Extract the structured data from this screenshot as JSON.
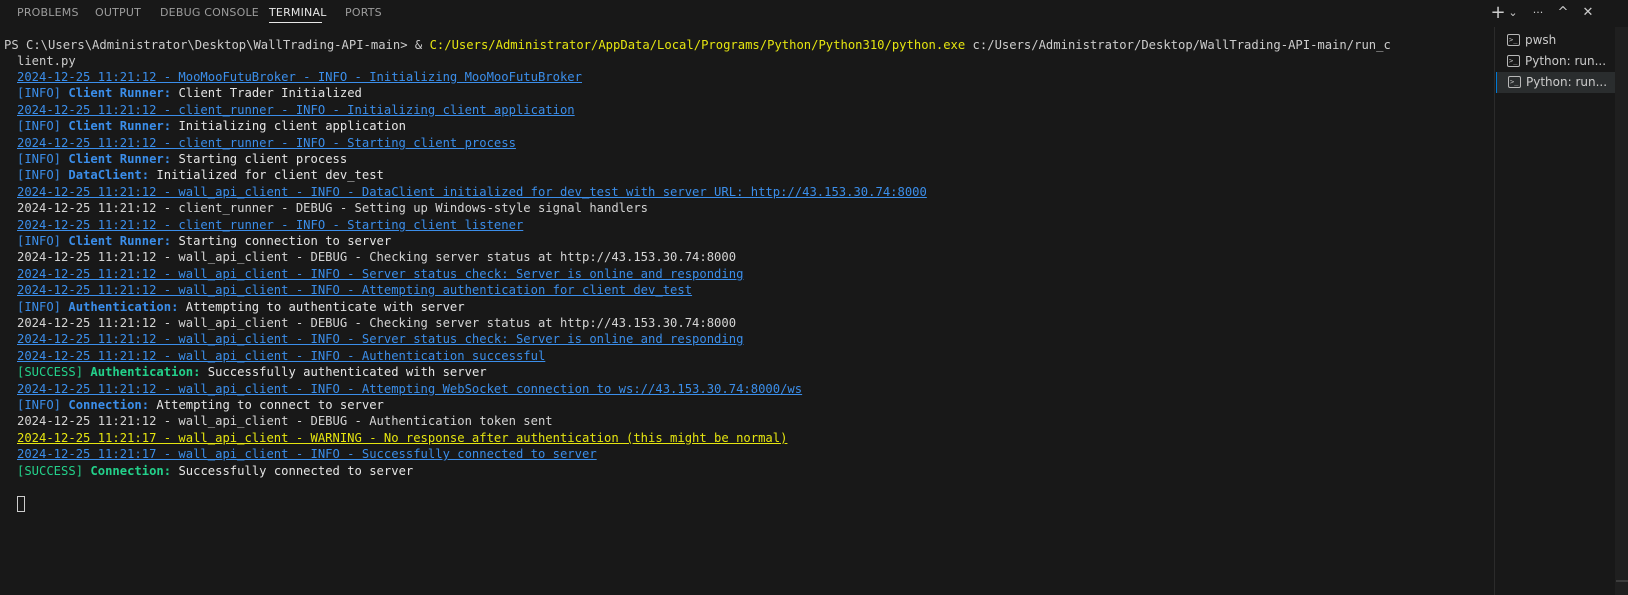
{
  "panel": {
    "tabs": [
      {
        "label": "PROBLEMS",
        "active": false
      },
      {
        "label": "OUTPUT",
        "active": false
      },
      {
        "label": "DEBUG CONSOLE",
        "active": false
      },
      {
        "label": "TERMINAL",
        "active": true
      },
      {
        "label": "PORTS",
        "active": false
      }
    ],
    "actions": [
      {
        "icon": "plus-icon",
        "glyph": "+"
      },
      {
        "icon": "chevron-down-icon",
        "glyph": "⌄"
      },
      {
        "icon": "more-icon",
        "glyph": "···"
      },
      {
        "icon": "maximize-icon",
        "glyph": "^"
      },
      {
        "icon": "close-icon",
        "glyph": "✕"
      }
    ]
  },
  "terminal": {
    "prompt": {
      "ps": "PS C:\\Users\\Administrator\\Desktop\\WallTrading-API-main> & ",
      "exe": "C:/Users/Administrator/AppData/Local/Programs/Python/Python310/python.exe",
      "args": " c:/Users/Administrator/Desktop/WallTrading-API-main/run_c",
      "cont": "lient.py"
    },
    "lines": [
      {
        "kind": "link",
        "text": "2024-12-25 11:21:12 - MooMooFutuBroker - INFO - Initializing MooMooFutuBroker"
      },
      {
        "kind": "tagged",
        "tag": "[INFO]",
        "source": "Client Runner:",
        "message": " Client Trader Initialized"
      },
      {
        "kind": "link",
        "text": "2024-12-25 11:21:12 - client_runner - INFO - Initializing client application"
      },
      {
        "kind": "tagged",
        "tag": "[INFO]",
        "source": "Client Runner:",
        "message": " Initializing client application"
      },
      {
        "kind": "link",
        "text": "2024-12-25 11:21:12 - client_runner - INFO - Starting client process"
      },
      {
        "kind": "tagged",
        "tag": "[INFO]",
        "source": "Client Runner:",
        "message": " Starting client process"
      },
      {
        "kind": "tagged",
        "tag": "[INFO]",
        "source": "DataClient:",
        "message": " Initialized for client dev_test"
      },
      {
        "kind": "link",
        "text": "2024-12-25 11:21:12 - wall_api_client - INFO - DataClient initialized for dev_test with server URL: http://43.153.30.74:8000"
      },
      {
        "kind": "plain",
        "text": "2024-12-25 11:21:12 - client_runner - DEBUG - Setting up Windows-style signal handlers"
      },
      {
        "kind": "link",
        "text": "2024-12-25 11:21:12 - client_runner - INFO - Starting client listener"
      },
      {
        "kind": "tagged",
        "tag": "[INFO]",
        "source": "Client Runner:",
        "message": " Starting connection to server"
      },
      {
        "kind": "plain",
        "text": "2024-12-25 11:21:12 - wall_api_client - DEBUG - Checking server status at http://43.153.30.74:8000"
      },
      {
        "kind": "link",
        "text": "2024-12-25 11:21:12 - wall_api_client - INFO - Server status check: Server is online and responding"
      },
      {
        "kind": "link",
        "text": "2024-12-25 11:21:12 - wall_api_client - INFO - Attempting authentication for client dev_test"
      },
      {
        "kind": "tagged",
        "tag": "[INFO]",
        "source": "Authentication:",
        "message": " Attempting to authenticate with server"
      },
      {
        "kind": "plain",
        "text": "2024-12-25 11:21:12 - wall_api_client - DEBUG - Checking server status at http://43.153.30.74:8000"
      },
      {
        "kind": "link",
        "text": "2024-12-25 11:21:12 - wall_api_client - INFO - Server status check: Server is online and responding"
      },
      {
        "kind": "link",
        "text": "2024-12-25 11:21:12 - wall_api_client - INFO - Authentication successful"
      },
      {
        "kind": "success",
        "tag": "[SUCCESS]",
        "source": "Authentication:",
        "message": " Successfully authenticated with server"
      },
      {
        "kind": "link",
        "text": "2024-12-25 11:21:12 - wall_api_client - INFO - Attempting WebSocket connection to ws://43.153.30.74:8000/ws"
      },
      {
        "kind": "tagged",
        "tag": "[INFO]",
        "source": "Connection:",
        "message": " Attempting to connect to server"
      },
      {
        "kind": "plain",
        "text": "2024-12-25 11:21:12 - wall_api_client - DEBUG - Authentication token sent"
      },
      {
        "kind": "warn",
        "text": "2024-12-25 11:21:17 - wall_api_client - WARNING - No response after authentication (this might be normal)"
      },
      {
        "kind": "link",
        "text": "2024-12-25 11:21:17 - wall_api_client - INFO - Successfully connected to server"
      },
      {
        "kind": "success",
        "tag": "[SUCCESS]",
        "source": "Connection:",
        "message": " Successfully connected to server"
      }
    ]
  },
  "terminal_list": {
    "items": [
      {
        "label": "pwsh",
        "active": false
      },
      {
        "label": "Python: run...",
        "active": false
      },
      {
        "label": "Python: run...",
        "active": true
      }
    ]
  }
}
